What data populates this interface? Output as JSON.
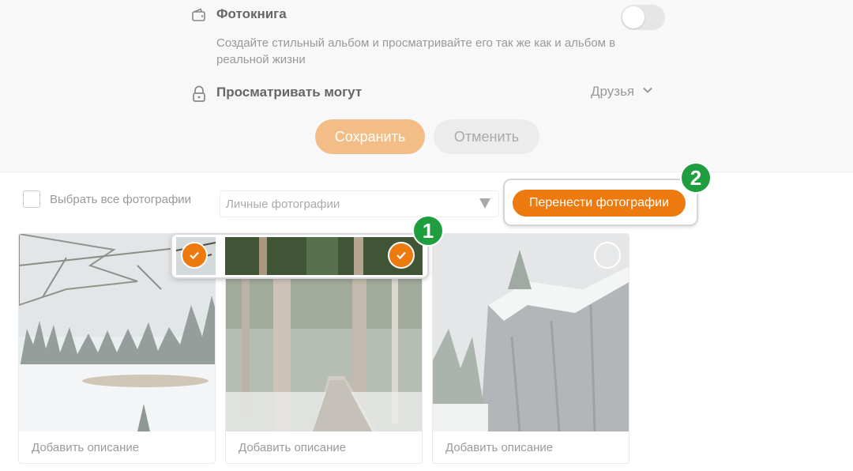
{
  "settings": {
    "photobook": {
      "title": "Фотокнига",
      "description": "Создайте стильный альбом и просматривайте его так же как и альбом в реальной жизни",
      "enabled": false
    },
    "visibility": {
      "title": "Просматривать могут",
      "value": "Друзья"
    },
    "save_label": "Сохранить",
    "cancel_label": "Отменить"
  },
  "toolbar": {
    "select_all_label": "Выбрать все фотографии",
    "album_select_value": "Личные фотографии",
    "move_button_label": "Перенести фотографии"
  },
  "annotations": {
    "badge_1": "1",
    "badge_2": "2"
  },
  "photos": [
    {
      "description_placeholder": "Добавить описание",
      "selected": true
    },
    {
      "description_placeholder": "Добавить описание",
      "selected": true
    },
    {
      "description_placeholder": "Добавить описание",
      "selected": false
    }
  ],
  "colors": {
    "accent": "#ed7a0e",
    "accent_muted": "#f2bd86",
    "annotation_green": "#1e9e3e"
  }
}
